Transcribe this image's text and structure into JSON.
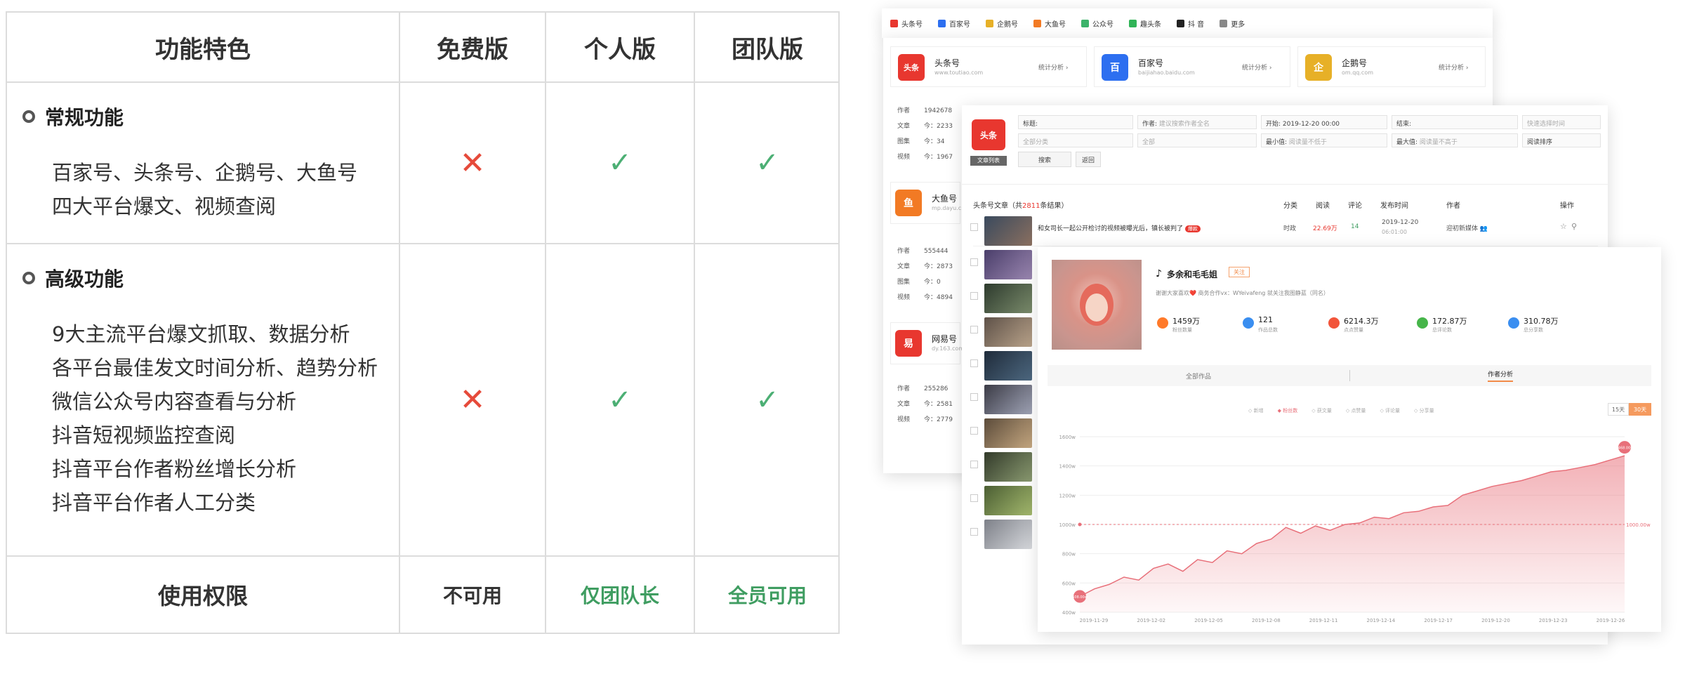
{
  "table": {
    "headers": [
      "功能特色",
      "免费版",
      "个人版",
      "团队版"
    ],
    "sections": [
      {
        "title": "常规功能",
        "features": [
          "百家号、头条号、企鹅号、大鱼号",
          "四大平台爆文、视频查阅"
        ],
        "free": "✕",
        "personal": "✓",
        "team": "✓"
      },
      {
        "title": "高级功能",
        "features": [
          "9大主流平台爆文抓取、数据分析",
          "各平台最佳发文时间分析、趋势分析",
          "微信公众号内容查看与分析",
          "抖音短视频监控查阅",
          "抖音平台作者粉丝增长分析",
          "抖音平台作者人工分类"
        ],
        "free": "✕",
        "personal": "✓",
        "team": "✓"
      }
    ],
    "permission": {
      "label": "使用权限",
      "free": "不可用",
      "personal": "仅团队长",
      "team": "全员可用"
    }
  },
  "colors": {
    "cross": "#e64a3a",
    "check": "#4caf74",
    "ok_text": "#3f9d61",
    "accent": "#ff7a59",
    "line": "#e8707a"
  },
  "platform_tabs": [
    {
      "label": "头条号",
      "color": "#e8372f"
    },
    {
      "label": "百家号",
      "color": "#2d6ff0"
    },
    {
      "label": "企鹅号",
      "color": "#e7b027"
    },
    {
      "label": "大鱼号",
      "color": "#f27a24"
    },
    {
      "label": "公众号",
      "color": "#3cb36a"
    },
    {
      "label": "趣头条",
      "color": "#30b457"
    },
    {
      "label": "抖 音",
      "color": "#222222"
    },
    {
      "label": "更多",
      "color": "#888888"
    }
  ],
  "platform_cards": [
    {
      "name": "头条号",
      "url": "www.toutiao.com",
      "stat": "统计分析 ›",
      "logo": "头条",
      "color": "#e8372f"
    },
    {
      "name": "百家号",
      "url": "baijiahao.baidu.com",
      "stat": "统计分析 ›",
      "logo": "百",
      "color": "#2d6ff0"
    },
    {
      "name": "企鹅号",
      "url": "om.qq.com",
      "stat": "统计分析 ›",
      "logo": "企",
      "color": "#e7b027"
    }
  ],
  "side_cards": [
    {
      "name": "",
      "rows": [
        [
          "作者",
          "1942678"
        ],
        [
          "文章",
          "今：2233"
        ],
        [
          "图集",
          "今：34"
        ],
        [
          "视频",
          "今：1967"
        ]
      ]
    },
    {
      "name": "大鱼号",
      "url": "mp.dayu.c",
      "logo": "鱼",
      "color": "#f27a24",
      "rows": [
        [
          "作者",
          "555444"
        ],
        [
          "文章",
          "今：2873"
        ],
        [
          "图集",
          "今：0"
        ],
        [
          "视频",
          "今：4894"
        ]
      ]
    },
    {
      "name": "网易号",
      "url": "dy.163.com",
      "logo": "易",
      "color": "#e8372f",
      "rows": [
        [
          "作者",
          "255286"
        ],
        [
          "文章",
          "今：2581"
        ],
        [
          "视频",
          "今：2779"
        ]
      ]
    }
  ],
  "filter": {
    "logo": "头条",
    "tag": "文章列表",
    "title_label": "标题:",
    "author_label": "作者:",
    "author_ph": "建议搜索作者全名",
    "start_label": "开始:",
    "start_value": "2019-12-20 00:00",
    "end_label": "结束:",
    "quick_ph": "快速选择时间",
    "cat_ph": "全部分类",
    "all_ph": "全部",
    "min_label": "最小值:",
    "min_ph": "阅读量不低于",
    "max_label": "最大值:",
    "max_ph": "阅读量不高于",
    "sort_ph": "阅读排序",
    "search_btn": "搜索",
    "back_btn": "返回"
  },
  "list": {
    "title_prefix": "头条号文章（共",
    "title_count": "2811",
    "title_suffix": "条结果）",
    "columns": [
      "分类",
      "阅读",
      "评论",
      "发布时间",
      "作者",
      "操作"
    ],
    "first_row": {
      "title": "和女司长一起公开检讨的视频被曝光后，镇长被判了",
      "badge": "爆款",
      "category": "时政",
      "reads": "22.69万",
      "comments": "14",
      "date": "2019-12-20",
      "time": "06:01:00",
      "author": "迎初新媒体 👥"
    }
  },
  "author": {
    "name": "多余和毛毛姐",
    "follow": "关注",
    "bio": "谢谢大家喜欢❤️ 商务合作vx：WYeivafeng 就关注我图静蓝（同名）",
    "stats": [
      {
        "value": "1459万",
        "label": "粉丝数量",
        "color": "#ff7a2a"
      },
      {
        "value": "121",
        "label": "作品总数",
        "color": "#3a8ef0"
      },
      {
        "value": "6214.3万",
        "label": "点点赞量",
        "color": "#f2553b"
      },
      {
        "value": "172.87万",
        "label": "总评论数",
        "color": "#46b54a"
      },
      {
        "value": "310.78万",
        "label": "总分享数",
        "color": "#3a8ef0"
      }
    ],
    "tabs": [
      "全部作品",
      "作者分析"
    ],
    "range_buttons": [
      "15天",
      "30天"
    ],
    "legend": [
      "新增",
      "粉丝数",
      "获文量",
      "点赞量",
      "评论量",
      "分享量"
    ]
  },
  "chart_data": {
    "type": "area",
    "series": [
      {
        "name": "粉丝数",
        "values": [
          508,
          560,
          590,
          640,
          620,
          700,
          730,
          680,
          760,
          740,
          820,
          800,
          870,
          900,
          980,
          940,
          990,
          960,
          1000,
          1010,
          1050,
          1040,
          1080,
          1090,
          1120,
          1130,
          1200,
          1230,
          1260,
          1280,
          1300,
          1330,
          1360,
          1370,
          1390,
          1410,
          1440,
          1470
        ]
      }
    ],
    "x_ticks": [
      "2019-11-29",
      "2019-12-02",
      "2019-12-05",
      "2019-12-08",
      "2019-12-11",
      "2019-12-14",
      "2019-12-17",
      "2019-12-20",
      "2019-12-23",
      "2019-12-26"
    ],
    "y_ticks": [
      "400w",
      "600w",
      "800w",
      "1000w",
      "1200w",
      "1400w",
      "1600w"
    ],
    "ylim": [
      400,
      1600
    ],
    "start_label": "508.00w",
    "end_label": "1468.00w",
    "ref_label": "1000.00w",
    "ref_value": 1000
  }
}
